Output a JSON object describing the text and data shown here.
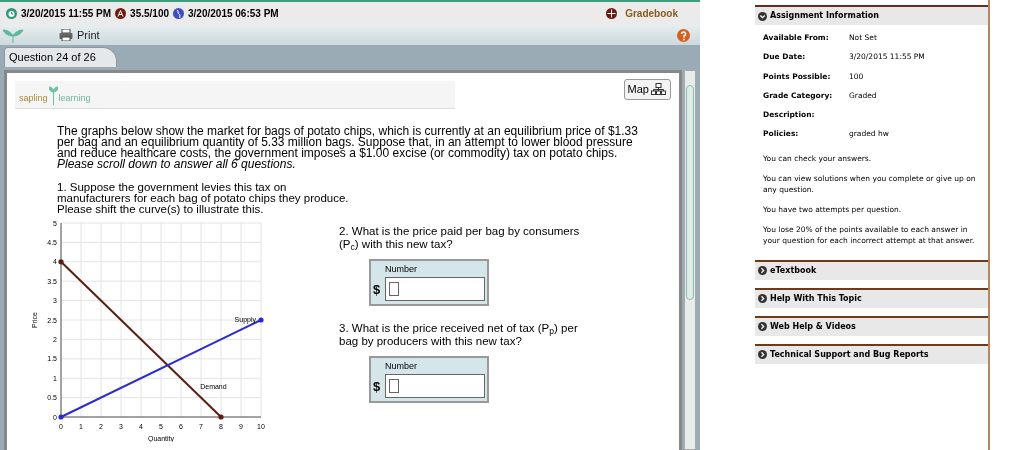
{
  "status_bar": {
    "due": "3/20/2015 11:55 PM",
    "score": "35.5/100",
    "now": "3/20/2015 06:53 PM",
    "gradebook": "Gradebook"
  },
  "toolbar": {
    "print": "Print"
  },
  "tabs": [
    {
      "label": "Question 24 of 26",
      "selected": true
    }
  ],
  "logo": {
    "left": "sapling",
    "right": "learning"
  },
  "map_button": "Map",
  "intro": {
    "text": "The graphs below show the market for bags of potato chips, which is currently at an equilibrium price of $1.33 per bag and an equilibrium quantity of 5.33 million bags. Suppose that, in an attempt to lower blood pressure and reduce healthcare costs, the government imposes a $1.00 excise (or commodity) tax on potato chips.",
    "note": "Please scroll down to answer all 6 questions."
  },
  "question_1": {
    "text": "1. Suppose the government levies this tax on manufacturers for each bag of potato chips they produce. Please shift the curve(s) to illustrate this.",
    "chart_data": {
      "type": "line",
      "xlabel": "Quantity",
      "ylabel": "Price",
      "x": [
        0,
        8,
        10
      ],
      "series": [
        {
          "name": "Demand",
          "color": "#5a1f12",
          "values": [
            4,
            0,
            null
          ]
        },
        {
          "name": "Supply",
          "color": "#2b2bd6",
          "values": [
            0,
            2,
            2.5
          ]
        }
      ],
      "xlim": [
        0,
        10
      ],
      "ylim": [
        0,
        5
      ],
      "xticks": [
        0,
        1,
        2,
        3,
        4,
        5,
        6,
        7,
        8,
        9,
        10
      ],
      "yticks": [
        0,
        0.5,
        1,
        1.5,
        2,
        2.5,
        3,
        3.5,
        4,
        4.5,
        5
      ],
      "grid": true
    }
  },
  "questions": [
    {
      "text": "2. What is the price paid per bag by consumers (P$_{c}$) with this new tax?",
      "field_label": "Number",
      "unit": "$"
    },
    {
      "text": "3. What is the price received net of tax (P$_{p}$) per bag by producers with this new tax?",
      "field_label": "Number",
      "unit": "$"
    }
  ],
  "sidebar": {
    "title": "Assignment Information",
    "expanded": true,
    "info": [
      {
        "label": "Available From:",
        "value": "Not Set"
      },
      {
        "label": "Due Date:",
        "value": "3/20/2015 11:55 PM"
      },
      {
        "label": "Points Possible:",
        "value": "100"
      },
      {
        "label": "Grade Category:",
        "value": "Graded"
      },
      {
        "label": "Description:"
      },
      {
        "label": "Policies:",
        "value": "graded hw"
      }
    ],
    "policies": [
      "You can check your answers.",
      "You can view solutions when you complete or give up on any question.",
      "You have two attempts per question.",
      "You lose 20% of the points available to each answer in your question for each incorrect attempt at that answer."
    ],
    "sections": [
      {
        "label": "eTextbook",
        "expanded": false
      },
      {
        "label": "Help With This Topic",
        "expanded": false
      },
      {
        "label": "Web Help & Videos",
        "expanded": false
      },
      {
        "label": "Technical Support and Bug Reports",
        "expanded": false
      }
    ]
  }
}
